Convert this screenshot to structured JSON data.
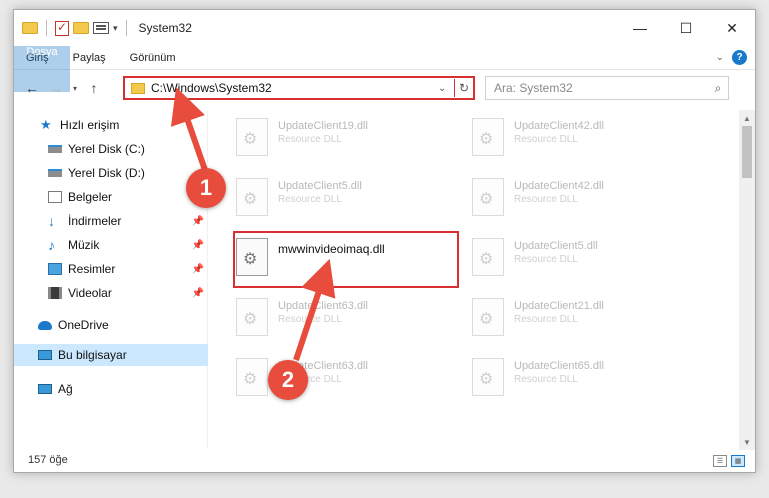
{
  "window": {
    "title": "System32"
  },
  "window_controls": {
    "minimize": "—",
    "maximize": "☐",
    "close": "✕"
  },
  "ribbon": {
    "tabs": [
      "Dosya",
      "Giriş",
      "Paylaş",
      "Görünüm"
    ],
    "help": "?"
  },
  "nav": {
    "back": "←",
    "forward": "→",
    "recent": "▾",
    "up": "↑"
  },
  "address": {
    "path": "C:\\Windows\\System32",
    "refresh": "↻",
    "dropdown": "⌄"
  },
  "search": {
    "placeholder": "Ara: System32",
    "icon": "⌕"
  },
  "sidebar": {
    "items": [
      {
        "label": "Hızlı erişim",
        "icon": "star-icon",
        "pinned": false
      },
      {
        "label": "Yerel Disk (C:)",
        "icon": "drive-icon",
        "pinned": false
      },
      {
        "label": "Yerel Disk (D:)",
        "icon": "drive-icon",
        "pinned": false
      },
      {
        "label": "Belgeler",
        "icon": "documents-icon",
        "pinned": false
      },
      {
        "label": "İndirmeler",
        "icon": "download-icon",
        "pinned": true
      },
      {
        "label": "Müzik",
        "icon": "music-icon",
        "pinned": true
      },
      {
        "label": "Resimler",
        "icon": "pictures-icon",
        "pinned": true
      },
      {
        "label": "Videolar",
        "icon": "videos-icon",
        "pinned": true
      },
      {
        "label": "OneDrive",
        "icon": "cloud-icon",
        "pinned": false
      },
      {
        "label": "Bu bilgisayar",
        "icon": "computer-icon",
        "pinned": false,
        "selected": true
      },
      {
        "label": "Ağ",
        "icon": "network-icon",
        "pinned": false
      }
    ],
    "pin_glyph": "📌"
  },
  "files": [
    {
      "name": "UpdateClient19.dll",
      "type": "Resource DLL"
    },
    {
      "name": "UpdateClient42.dll",
      "type": "Resource DLL"
    },
    {
      "name": "UpdateClient5.dll",
      "type": "Resource DLL"
    },
    {
      "name": "UpdateClient42.dll",
      "type": "Resource DLL"
    },
    {
      "name": "mwwinvideoimaq.dll",
      "type": "",
      "highlighted": true
    },
    {
      "name": "UpdateClient5.dll",
      "type": "Resource DLL"
    },
    {
      "name": "UpdateClient63.dll",
      "type": "Resource DLL"
    },
    {
      "name": "UpdateClient21.dll",
      "type": "Resource DLL"
    },
    {
      "name": "UpdateClient63.dll",
      "type": "Resource DLL"
    },
    {
      "name": "UpdateClient65.dll",
      "type": "Resource DLL"
    }
  ],
  "status": {
    "count": "157 öğe"
  },
  "annotations": {
    "step1": "1",
    "step2": "2",
    "color": "#e74c3c"
  },
  "scroll": {
    "up": "▲",
    "down": "▼"
  }
}
